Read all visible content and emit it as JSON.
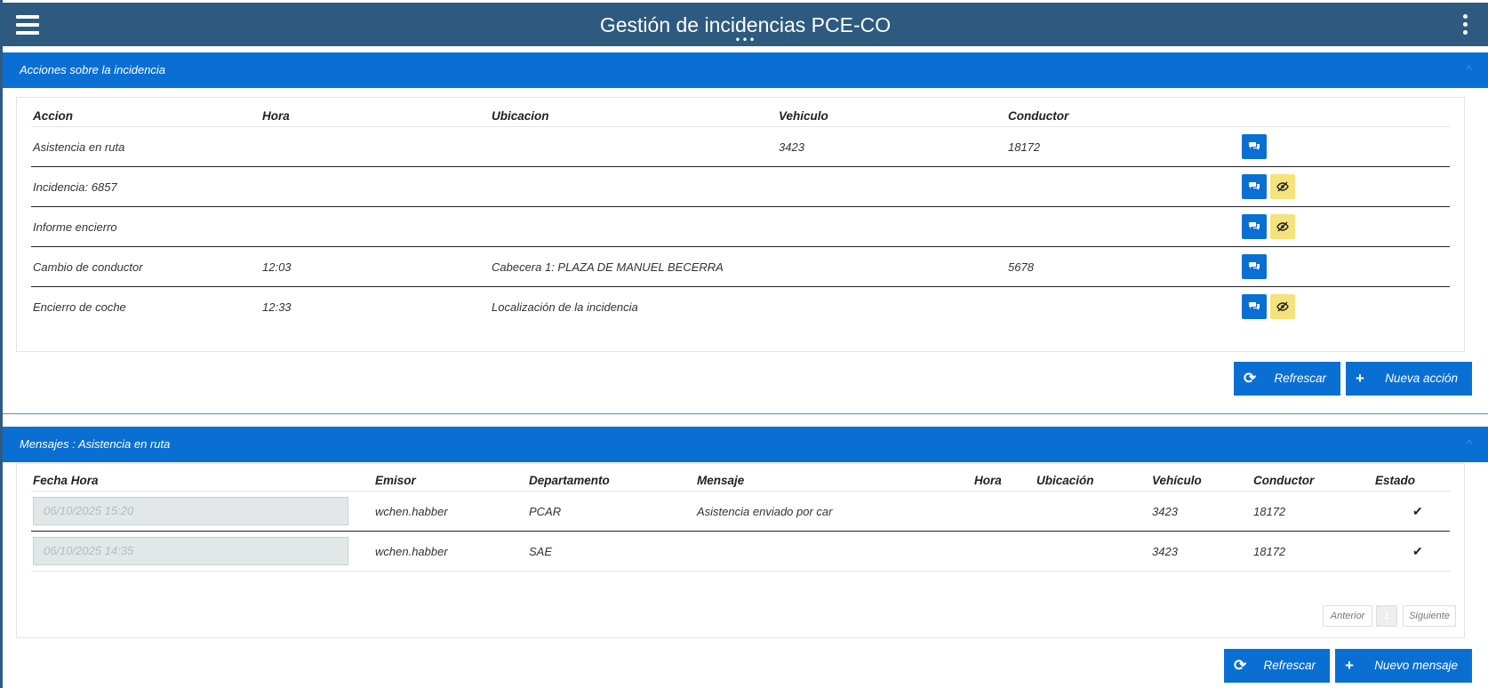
{
  "header": {
    "title": "Gestión de incidencias PCE-CO",
    "grip": "•••",
    "menu_icon": "hamburger-icon",
    "more_icon": "more-vertical-icon"
  },
  "actions_panel": {
    "title": "Acciones sobre la incidencia",
    "collapse_icon": "^",
    "columns": [
      "Accion",
      "Hora",
      "Ubicacion",
      "Vehiculo",
      "Conductor"
    ],
    "rows": [
      {
        "accion": "Asistencia en ruta",
        "hora": "",
        "ubicacion": "",
        "vehiculo": "3423",
        "conductor": "18172",
        "buttons": [
          "chat"
        ]
      },
      {
        "accion": "Incidencia: 6857",
        "hora": "",
        "ubicacion": "",
        "vehiculo": "",
        "conductor": "",
        "buttons": [
          "chat",
          "hide"
        ]
      },
      {
        "accion": "Informe encierro",
        "hora": "",
        "ubicacion": "",
        "vehiculo": "",
        "conductor": "",
        "buttons": [
          "chat",
          "hide"
        ]
      },
      {
        "accion": "Cambio de conductor",
        "hora": "12:03",
        "ubicacion": "Cabecera 1: PLAZA DE MANUEL BECERRA",
        "vehiculo": "",
        "conductor": "5678",
        "buttons": [
          "chat"
        ]
      },
      {
        "accion": "Encierro de coche",
        "hora": "12:33",
        "ubicacion": "Localización de la incidencia",
        "vehiculo": "",
        "conductor": "",
        "buttons": [
          "chat",
          "hide"
        ]
      }
    ],
    "refresh_label": "Refrescar",
    "new_label": "Nueva acción"
  },
  "messages_panel": {
    "title": "Mensajes : Asistencia en ruta",
    "collapse_icon": "^",
    "columns": [
      "Fecha Hora",
      "Emisor",
      "Departamento",
      "Mensaje",
      "Hora",
      "Ubicación",
      "Vehículo",
      "Conductor",
      "Estado"
    ],
    "rows": [
      {
        "fecha": "06/10/2025 15:20",
        "emisor": "wchen.habber",
        "departamento": "PCAR",
        "mensaje": "Asistencia enviado por car",
        "hora": "",
        "ubicacion": "",
        "vehiculo": "3423",
        "conductor": "18172",
        "estado": "✔"
      },
      {
        "fecha": "06/10/2025 14:35",
        "emisor": "wchen.habber",
        "departamento": "SAE",
        "mensaje": "",
        "hora": "",
        "ubicacion": "",
        "vehiculo": "3423",
        "conductor": "18172",
        "estado": "✔"
      }
    ],
    "pager": {
      "prev": "Anterior",
      "page": "1",
      "next": "Siguiente"
    },
    "refresh_label": "Refrescar",
    "new_label": "Nuevo mensaje"
  },
  "colors": {
    "topbar": "#2e5a80",
    "panel_header": "#0a6fd3",
    "button": "#0a6fd3",
    "hide_button": "#f4e27a",
    "date_field": "#e2e8e8"
  }
}
